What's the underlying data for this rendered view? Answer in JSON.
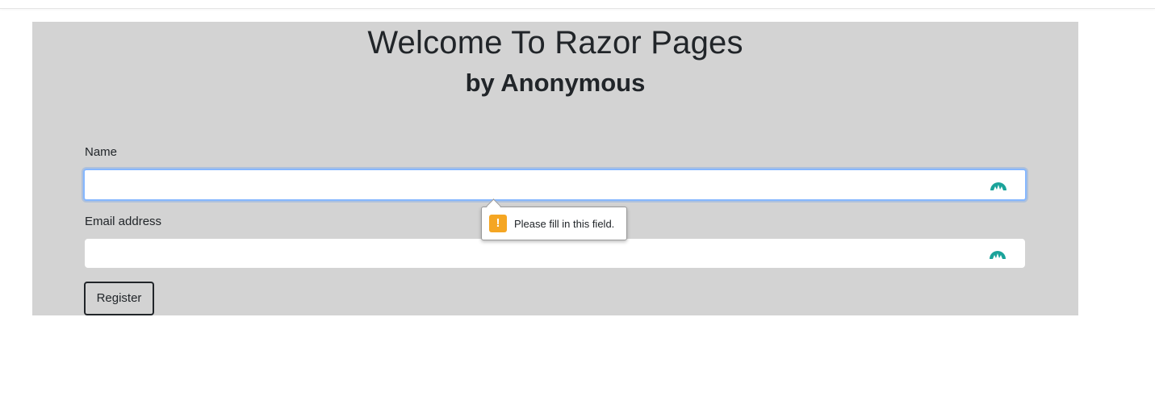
{
  "page": {
    "title": "Welcome To Razor Pages",
    "subtitle": "by Anonymous"
  },
  "form": {
    "name_label": "Name",
    "name_value": "",
    "email_label": "Email address",
    "email_value": "",
    "register_label": "Register"
  },
  "validation": {
    "message": "Please fill in this field.",
    "icon": "warning-icon"
  },
  "colors": {
    "panel_background": "#d3d3d3",
    "focus_border": "#86b7fe",
    "warning": "#f5a623",
    "extension_icon": "#1aa39a"
  },
  "icons": {
    "field_extension_icon": "password-manager-icon"
  }
}
